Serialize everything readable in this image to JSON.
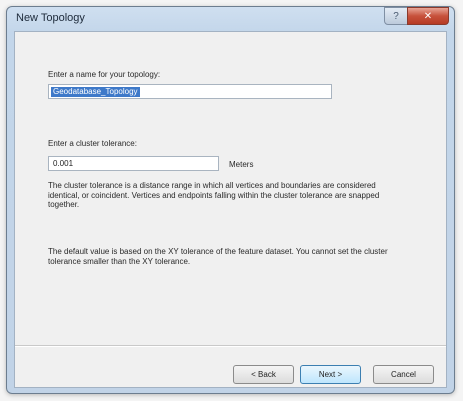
{
  "window": {
    "title": "New Topology",
    "help_label": "?",
    "close_label": "✕"
  },
  "form": {
    "name_label": "Enter a name for your topology:",
    "name_value": "Geodatabase_Topology",
    "tolerance_label": "Enter a cluster tolerance:",
    "tolerance_value": "0.001",
    "tolerance_unit": "Meters",
    "description_1": "The cluster tolerance is a distance range in which all vertices and boundaries are considered identical, or coincident. Vertices and endpoints falling within the cluster tolerance are snapped together.",
    "description_2": "The default value is based on the XY tolerance of the feature dataset. You cannot set the cluster tolerance smaller than the XY tolerance."
  },
  "buttons": {
    "back": "< Back",
    "next": "Next >",
    "cancel": "Cancel"
  }
}
